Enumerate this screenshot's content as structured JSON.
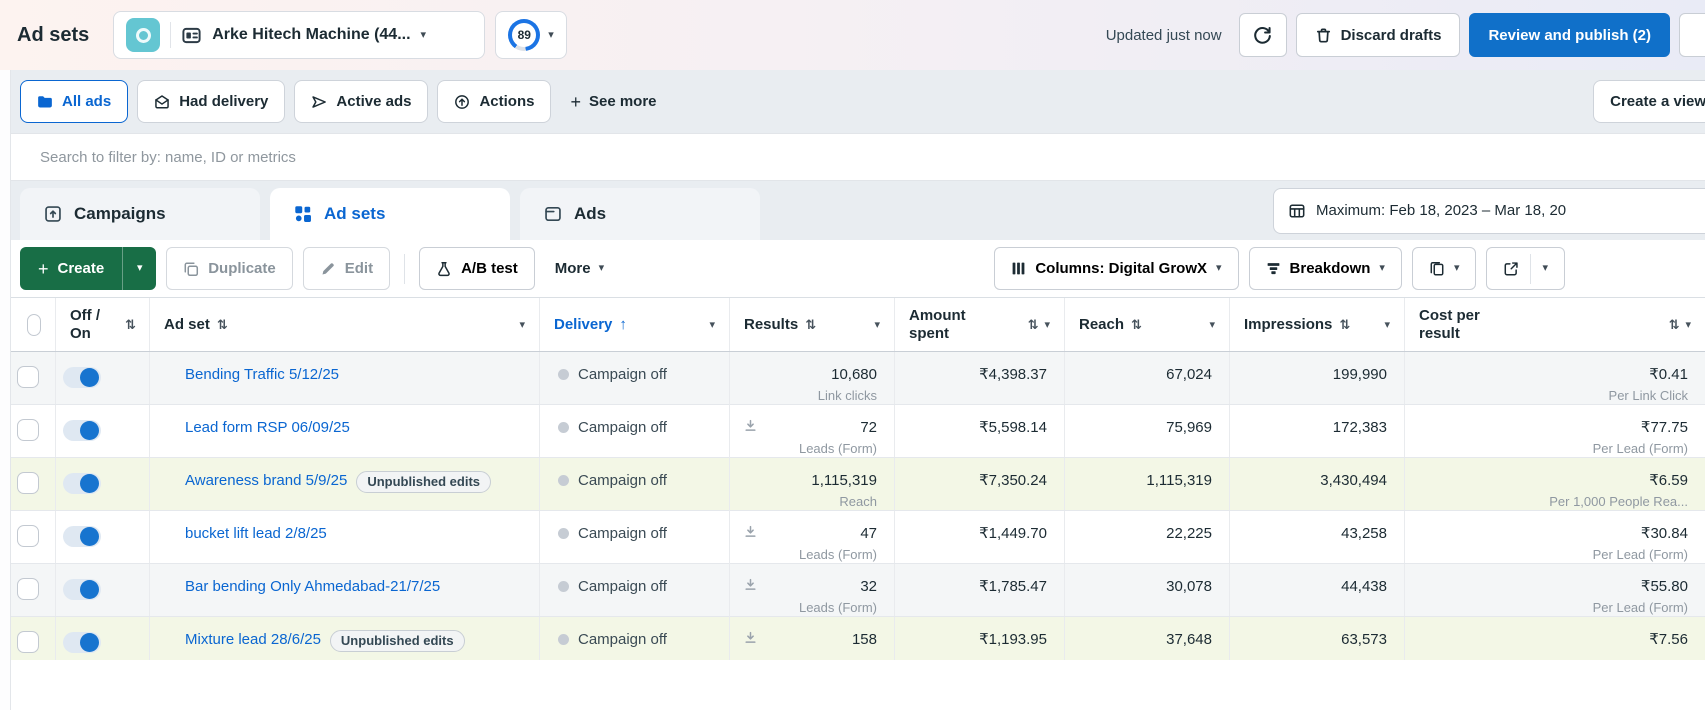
{
  "header": {
    "title": "Ad sets",
    "account_name": "Arke Hitech Machine (44...",
    "score": "89",
    "updated": "Updated just now",
    "discard": "Discard drafts",
    "review": "Review and publish (2)"
  },
  "filters": {
    "pills": [
      {
        "label": "All ads",
        "active": true
      },
      {
        "label": "Had delivery",
        "active": false
      },
      {
        "label": "Active ads",
        "active": false
      },
      {
        "label": "Actions",
        "active": false
      }
    ],
    "see_more": "See more",
    "create_view": "Create a view"
  },
  "search": {
    "placeholder": "Search to filter by: name, ID or metrics"
  },
  "tabs": [
    {
      "label": "Campaigns",
      "active": false
    },
    {
      "label": "Ad sets",
      "active": true
    },
    {
      "label": "Ads",
      "active": false
    }
  ],
  "date_range": "Maximum: Feb 18, 2023 – Mar 18, 20",
  "toolbar": {
    "create": "Create",
    "duplicate": "Duplicate",
    "edit": "Edit",
    "ab_test": "A/B test",
    "more": "More",
    "columns": "Columns: Digital GrowX",
    "breakdown": "Breakdown"
  },
  "icons": {
    "caret": "▾",
    "sort": "⇅",
    "sort_up": "↑",
    "plus": "+",
    "dots": "···"
  },
  "colors": {
    "accent_blue": "#0a66d1",
    "button_blue": "#1070c9",
    "create_green": "#186e46",
    "unpublished_row_green": "#f3f7e6",
    "marker_green": "#86c31e",
    "topbar_gradient_left": "#fdf3f0",
    "topbar_gradient_right": "#e9ebf6"
  },
  "table": {
    "columns": [
      {
        "label": "Off / On"
      },
      {
        "label": "Ad set"
      },
      {
        "label": "Delivery"
      },
      {
        "label": "Results"
      },
      {
        "label": "Amount spent"
      },
      {
        "label": "Reach"
      },
      {
        "label": "Impressions"
      },
      {
        "label": "Cost per result"
      }
    ],
    "rows": [
      {
        "name": "Bending Traffic 5/12/25",
        "badge": null,
        "shade": true,
        "download": false,
        "delivery": "Campaign off",
        "results": "10,680",
        "results_label": "Link clicks",
        "spent": "₹4,398.37",
        "reach": "67,024",
        "impressions": "199,990",
        "cost": "₹0.41",
        "cost_label": "Per Link Click"
      },
      {
        "name": "Lead form RSP 06/09/25",
        "badge": null,
        "shade": false,
        "download": true,
        "delivery": "Campaign off",
        "results": "72",
        "results_label": "Leads (Form)",
        "spent": "₹5,598.14",
        "reach": "75,969",
        "impressions": "172,383",
        "cost": "₹77.75",
        "cost_label": "Per Lead (Form)"
      },
      {
        "name": "Awareness brand 5/9/25",
        "badge": "Unpublished edits",
        "shade": false,
        "download": false,
        "delivery": "Campaign off",
        "results": "1,115,319",
        "results_label": "Reach",
        "spent": "₹7,350.24",
        "reach": "1,115,319",
        "impressions": "3,430,494",
        "cost": "₹6.59",
        "cost_label": "Per 1,000 People Rea..."
      },
      {
        "name": "bucket lift lead 2/8/25",
        "badge": null,
        "shade": false,
        "download": true,
        "delivery": "Campaign off",
        "results": "47",
        "results_label": "Leads (Form)",
        "spent": "₹1,449.70",
        "reach": "22,225",
        "impressions": "43,258",
        "cost": "₹30.84",
        "cost_label": "Per Lead (Form)"
      },
      {
        "name": "Bar bending Only Ahmedabad-21/7/25",
        "badge": null,
        "shade": true,
        "download": true,
        "delivery": "Campaign off",
        "results": "32",
        "results_label": "Leads (Form)",
        "spent": "₹1,785.47",
        "reach": "30,078",
        "impressions": "44,438",
        "cost": "₹55.80",
        "cost_label": "Per Lead (Form)"
      },
      {
        "name": "Mixture lead 28/6/25",
        "badge": "Unpublished edits",
        "shade": false,
        "download": true,
        "delivery": "Campaign off",
        "results": "158",
        "results_label": "",
        "spent": "₹1,193.95",
        "reach": "37,648",
        "impressions": "63,573",
        "cost": "₹7.56",
        "cost_label": ""
      }
    ]
  }
}
